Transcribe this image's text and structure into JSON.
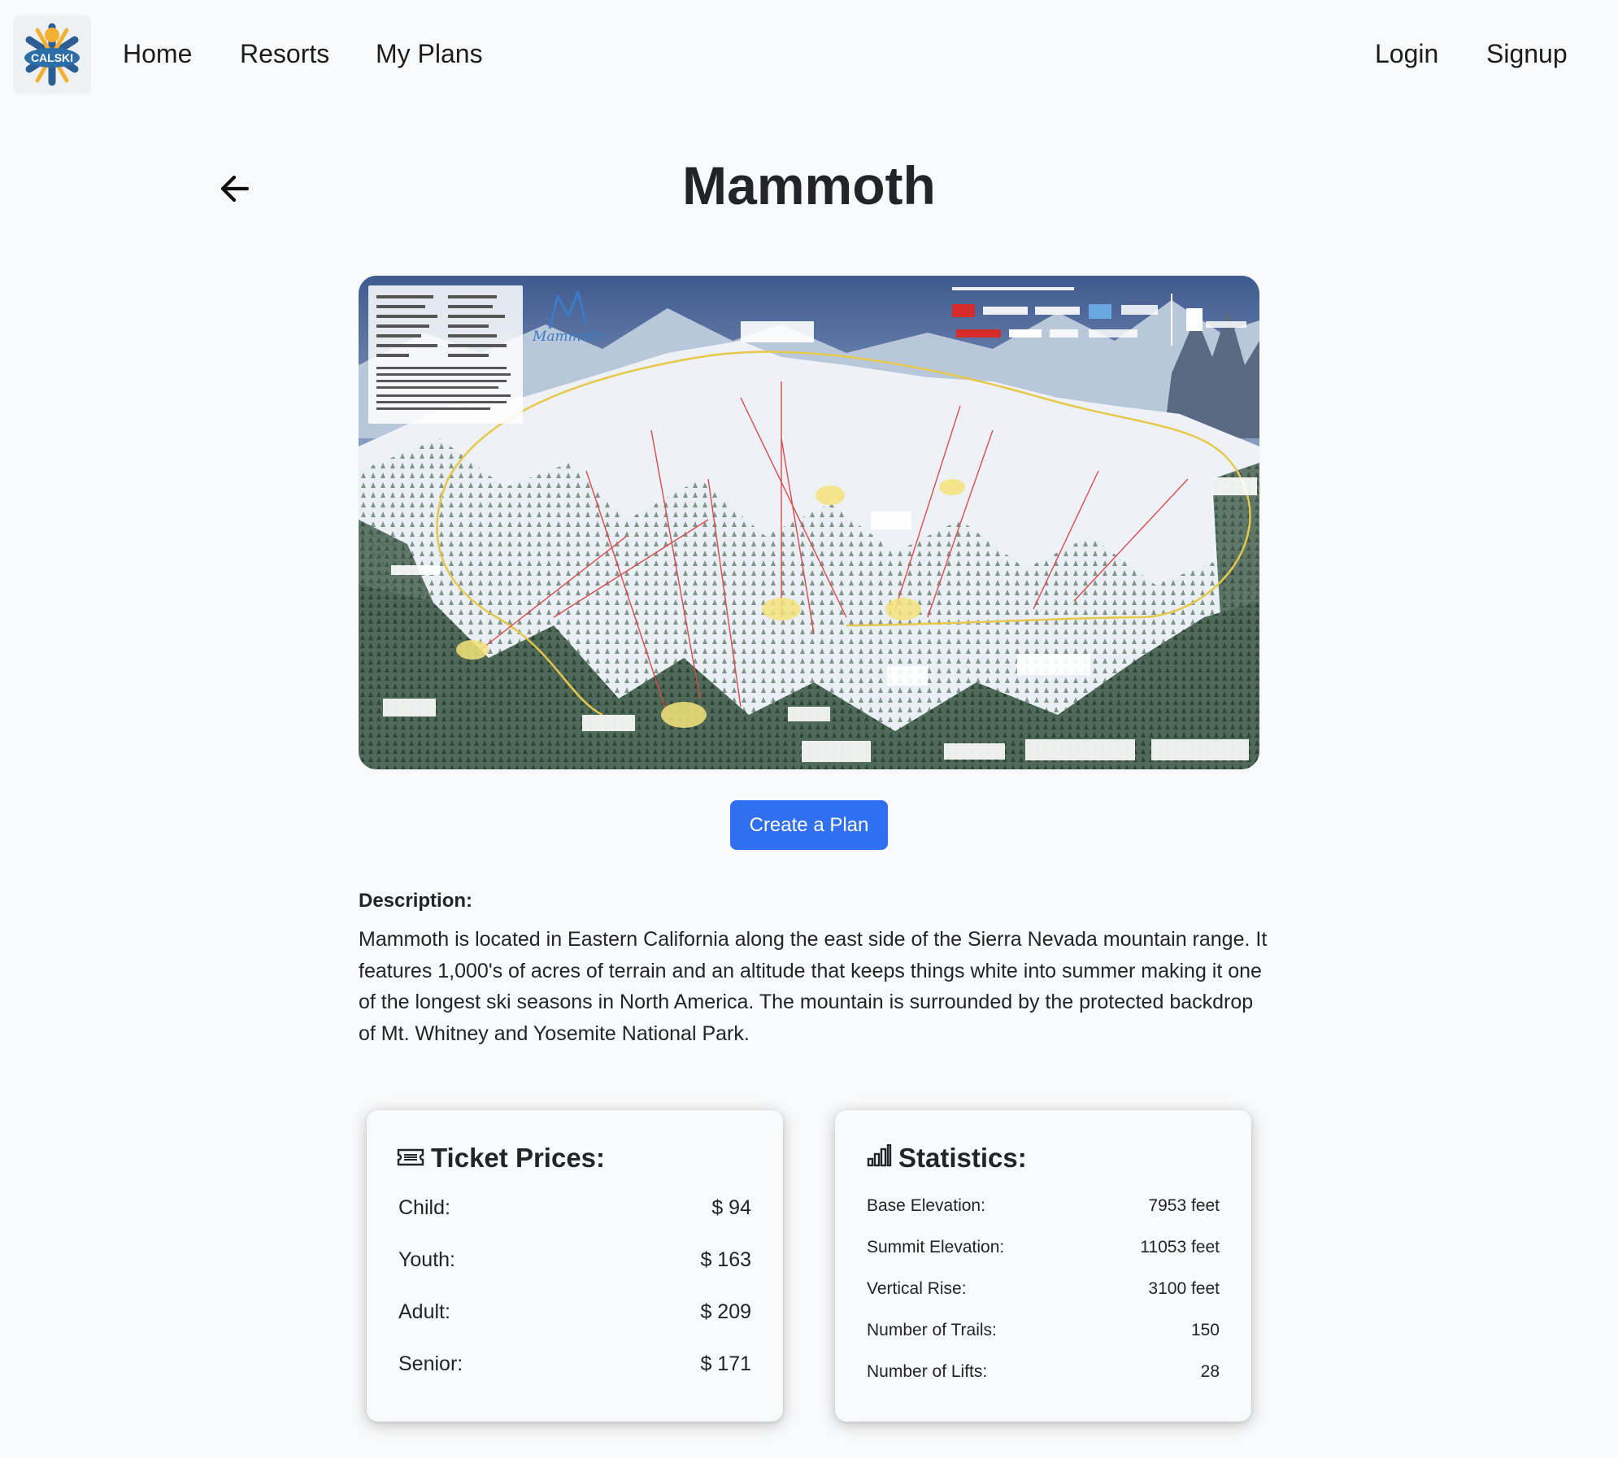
{
  "nav": {
    "logo_text": "CALSKI",
    "links": [
      "Home",
      "Resorts",
      "My Plans"
    ],
    "auth": [
      "Login",
      "Signup"
    ]
  },
  "resort": {
    "name": "Mammoth",
    "map_brand": "Mammoth"
  },
  "actions": {
    "create_plan": "Create a Plan"
  },
  "description": {
    "label": "Description:",
    "text": "Mammoth is located in Eastern California along the east side of the Sierra Nevada mountain range. It features 1,000's of acres of terrain and an altitude that keeps things white into summer making it one of the longest ski seasons in North America. The mountain is surrounded by the protected backdrop of Mt. Whitney and Yosemite National Park."
  },
  "tickets": {
    "title": "Ticket Prices:",
    "icon": "ticket-icon",
    "rows": [
      {
        "label": "Child:",
        "value": "$ 94"
      },
      {
        "label": "Youth:",
        "value": "$ 163"
      },
      {
        "label": "Adult:",
        "value": "$ 209"
      },
      {
        "label": "Senior:",
        "value": "$ 171"
      }
    ]
  },
  "stats": {
    "title": "Statistics:",
    "icon": "bar-chart-icon",
    "rows": [
      {
        "label": "Base Elevation:",
        "value": "7953 feet"
      },
      {
        "label": "Summit Elevation:",
        "value": "11053 feet"
      },
      {
        "label": "Vertical Rise:",
        "value": "3100 feet"
      },
      {
        "label": "Number of Trails:",
        "value": "150"
      },
      {
        "label": "Number of Lifts:",
        "value": "28"
      }
    ]
  },
  "colors": {
    "primary_button": "#2f6ff0",
    "background": "#f8f9fa",
    "text": "#212529"
  }
}
